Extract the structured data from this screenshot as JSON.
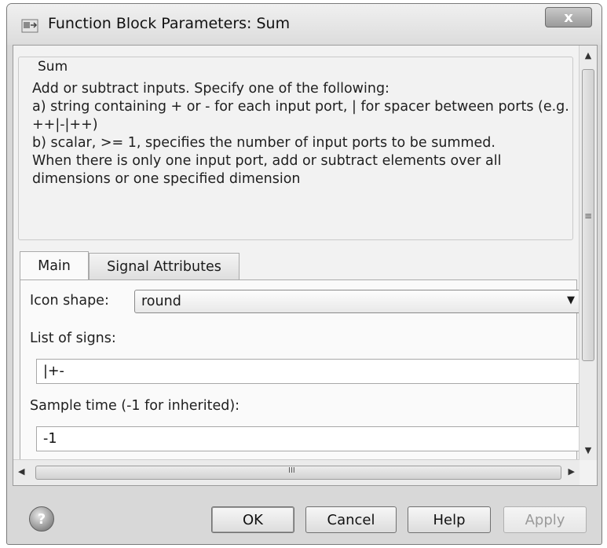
{
  "window": {
    "title": "Function Block Parameters: Sum",
    "close_symbol": "x"
  },
  "block": {
    "name": "Sum",
    "description": "Add or subtract inputs.  Specify one of the following:\na) string containing + or - for each input port, | for spacer between ports (e.g. ++|-|++)\nb) scalar, >= 1, specifies the number of input ports to be summed.\nWhen there is only one input port, add or subtract elements over all dimensions or one specified dimension"
  },
  "tabs": [
    {
      "label": "Main",
      "active": true
    },
    {
      "label": "Signal Attributes",
      "active": false
    }
  ],
  "main": {
    "icon_shape_label": "Icon shape:",
    "icon_shape_value": "round",
    "list_of_signs_label": "List of signs:",
    "list_of_signs_value": "|+-",
    "sample_time_label": "Sample time (-1 for inherited):",
    "sample_time_value": "-1"
  },
  "scrollbars": {
    "up_arrow": "▲",
    "down_arrow": "▼",
    "left_arrow": "◀",
    "right_arrow": "▶",
    "grip_v": "≡",
    "grip_h": "III"
  },
  "buttons": {
    "ok": "OK",
    "cancel": "Cancel",
    "help": "Help",
    "apply": "Apply",
    "help_icon_glyph": "?"
  },
  "icons": {
    "app_icon": "simulink-block-icon",
    "help_icon": "help-circle-icon",
    "close_icon": "close-icon",
    "dropdown_icon": "chevron-down-icon"
  }
}
